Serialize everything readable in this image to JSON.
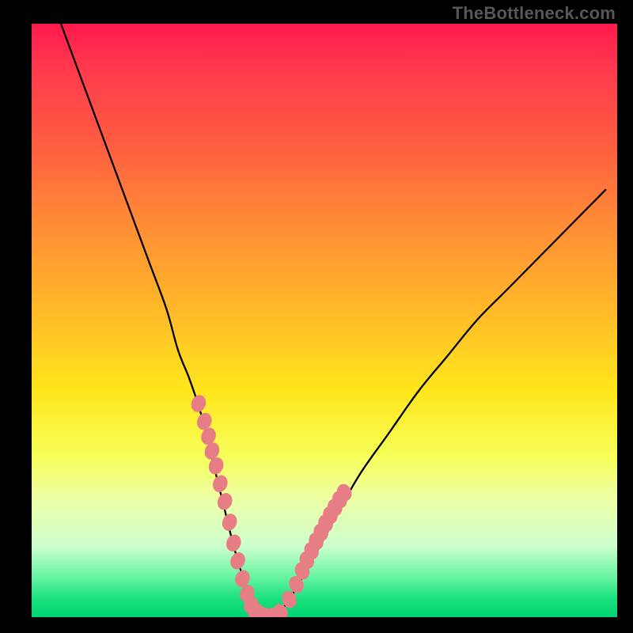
{
  "attribution": "TheBottleneck.com",
  "chart_data": {
    "type": "line",
    "title": "",
    "xlabel": "",
    "ylabel": "",
    "xlim": [
      0,
      100
    ],
    "ylim": [
      0,
      100
    ],
    "series": [
      {
        "name": "bottleneck-curve",
        "x": [
          5,
          8,
          11,
          14,
          17,
          20,
          23,
          25,
          27,
          29,
          31,
          33,
          34.5,
          36,
          37.5,
          39,
          40.5,
          42,
          44,
          47,
          52,
          56,
          61,
          66,
          71,
          76,
          81,
          86,
          91,
          95,
          98
        ],
        "y": [
          100,
          92,
          84,
          76,
          68,
          60,
          52,
          45,
          40,
          34,
          26,
          18,
          12,
          7,
          3,
          0.5,
          0,
          0.5,
          3,
          8,
          17,
          24,
          31,
          38,
          44,
          50,
          55,
          60,
          65,
          69,
          72
        ]
      }
    ],
    "data_points": {
      "name": "highlighted-range-markers",
      "x": [
        28.5,
        29.5,
        30.2,
        30.8,
        31.5,
        32.2,
        33.0,
        33.8,
        34.5,
        35.2,
        36.0,
        36.8,
        37.5,
        38.2,
        39.0,
        40.0,
        41.0,
        42.5,
        44.0,
        45.2,
        46.2,
        47.0,
        47.8,
        48.6,
        49.4,
        50.2,
        51.0,
        51.8,
        52.6,
        53.4
      ],
      "y": [
        36,
        33,
        30.5,
        28,
        25.5,
        22.5,
        19.5,
        16,
        12.5,
        9.5,
        6.5,
        4,
        2,
        1,
        0.4,
        0.1,
        0.1,
        0.8,
        3,
        5.5,
        7.8,
        9.6,
        11.2,
        12.8,
        14.3,
        15.8,
        17.2,
        18.5,
        19.8,
        21.0
      ]
    },
    "colors": {
      "curve": "#000000",
      "points": "#e77d85",
      "gradient_top": "#ff1a4d",
      "gradient_bottom": "#00d472"
    }
  }
}
